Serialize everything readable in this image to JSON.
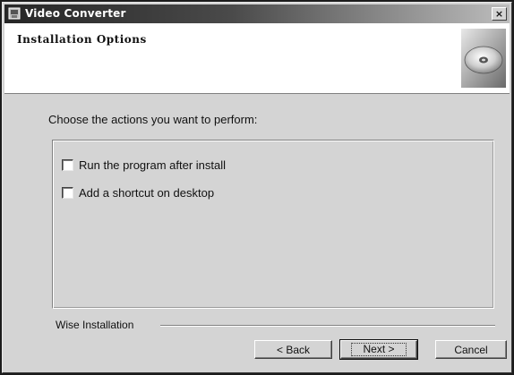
{
  "window": {
    "title": "Video Converter",
    "close_label": "×"
  },
  "header": {
    "title": "Installation Options",
    "logo_icon": "cd-disc-icon"
  },
  "main": {
    "instruction": "Choose the actions you want to perform:",
    "options": [
      {
        "label": "Run the program after install",
        "checked": false
      },
      {
        "label": "Add a shortcut on desktop",
        "checked": false
      }
    ]
  },
  "footer": {
    "brand": "Wise Installation",
    "back_label": "< Back",
    "next_label": "Next >",
    "cancel_label": "Cancel"
  }
}
